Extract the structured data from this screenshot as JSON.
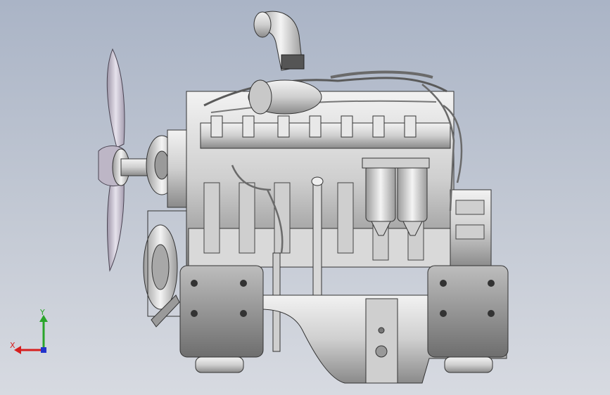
{
  "viewport": {
    "background_top": "#aab4c6",
    "background_bottom": "#d7dae1"
  },
  "model": {
    "icon": "engine-assembly"
  },
  "triad": {
    "x_label": "X",
    "y_label": "Y",
    "x_color": "#d61f1f",
    "y_color": "#2aa52a",
    "z_color": "#2233cc"
  }
}
